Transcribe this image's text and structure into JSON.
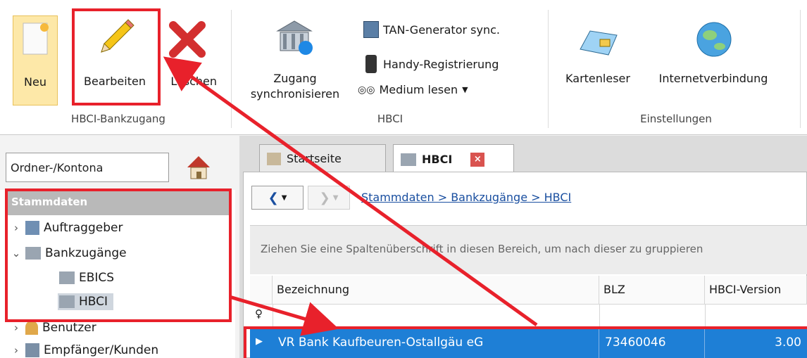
{
  "ribbon": {
    "new_label": "Neu",
    "edit_label": "Bearbeiten",
    "delete_label": "Löschen",
    "bank_group_label": "HBCI-Bankzugang",
    "sync_label_1": "Zugang",
    "sync_label_2": "synchronisieren",
    "tan_sync_label": "TAN-Generator sync.",
    "handy_label": "Handy-Registrierung",
    "medium_label": "Medium lesen",
    "hbci_group_label": "HBCI",
    "card_reader_label": "Kartenleser",
    "internet_label": "Internetverbindung",
    "settings_group_label": "Einstellungen"
  },
  "sidebar": {
    "search_value": "Ordner-/Kontona",
    "header": "Stammdaten",
    "items": [
      {
        "label": "Auftraggeber"
      },
      {
        "label": "Bankzugänge"
      },
      {
        "label": "EBICS"
      },
      {
        "label": "HBCI"
      },
      {
        "label": "Benutzer"
      },
      {
        "label": "Empfänger/Kunden"
      }
    ]
  },
  "tabs": [
    {
      "label": "Startseite"
    },
    {
      "label": "HBCI"
    }
  ],
  "breadcrumb": "Stammdaten > Bankzugänge > HBCI",
  "group_hint": "Ziehen Sie eine Spaltenüberschrift in diesen Bereich, um nach dieser zu gruppieren",
  "table": {
    "columns": [
      "Bezeichnung",
      "BLZ",
      "HBCI-Version"
    ],
    "rows": [
      {
        "name": "VR Bank Kaufbeuren-Ostallgäu eG",
        "blz": "73460046",
        "version": "3.00"
      }
    ]
  },
  "colors": {
    "selection": "#1e7fd6",
    "highlight": "#e8212b",
    "link": "#1a4fa0"
  }
}
